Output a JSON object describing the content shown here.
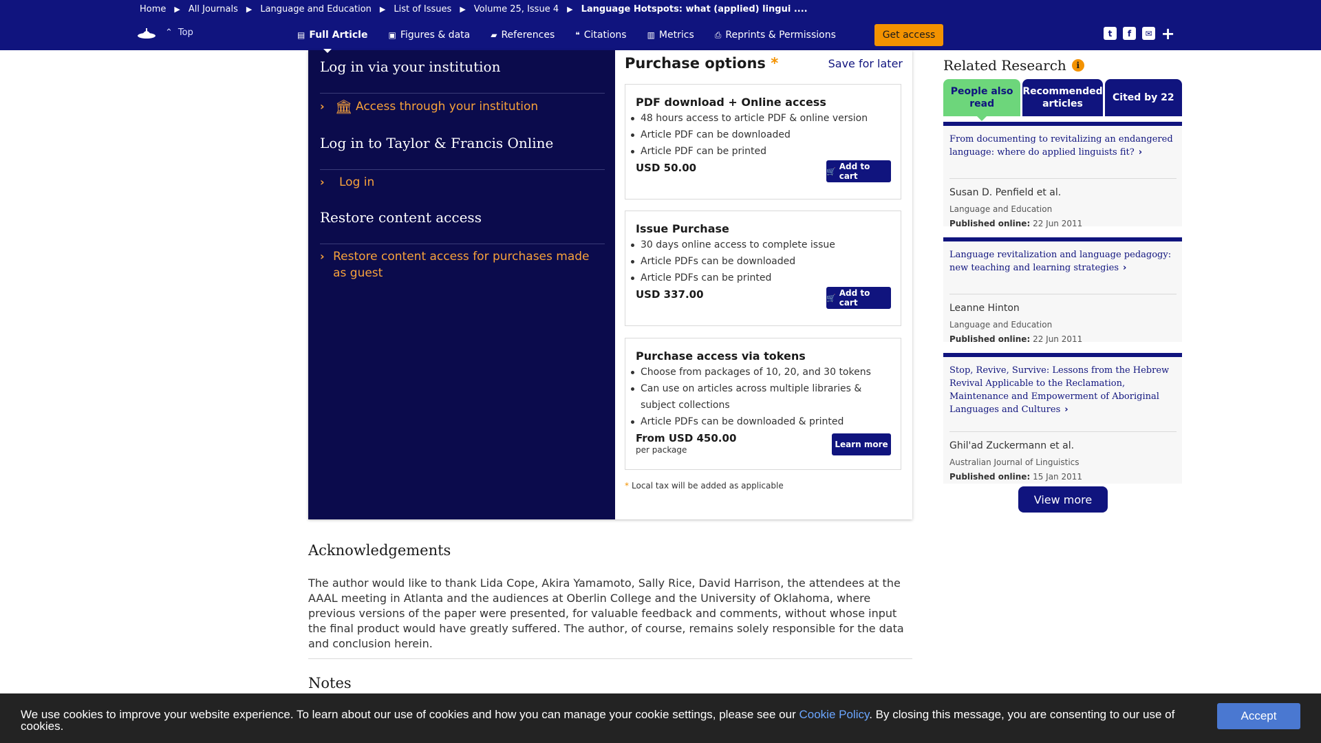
{
  "breadcrumbs": [
    "Home",
    "All Journals",
    "Language and Education",
    "List of Issues",
    "Volume 25, Issue 4",
    "Language Hotspots: what (applied) lingui ...."
  ],
  "header": {
    "top_link": "Top",
    "tabs": [
      {
        "label": "Full Article",
        "icon": "document-icon"
      },
      {
        "label": "Figures & data",
        "icon": "image-icon"
      },
      {
        "label": "References",
        "icon": "book-icon"
      },
      {
        "label": "Citations",
        "icon": "quote-icon"
      },
      {
        "label": "Metrics",
        "icon": "bar-chart-icon"
      },
      {
        "label": "Reprints & Permissions",
        "icon": "printer-icon"
      }
    ],
    "get_access": "Get access",
    "share_icons": [
      "twitter-icon",
      "facebook-icon",
      "email-icon",
      "plus-icon"
    ],
    "bar_color": "#10147e",
    "accent_color": "#f39200"
  },
  "login": {
    "institution_heading": "Log in via your institution",
    "institution_link": "Access through your institution",
    "tf_heading": "Log in to Taylor & Francis Online",
    "tf_link": "Log in",
    "restore_heading": "Restore content access",
    "restore_link": "Restore content access for purchases made as guest"
  },
  "purchase": {
    "title": "Purchase options",
    "star": "*",
    "save_later": "Save for later",
    "options": [
      {
        "title": "PDF download + Online access",
        "features": [
          "48 hours access to article PDF & online version",
          "Article PDF can be downloaded",
          "Article PDF can be printed"
        ],
        "price": "USD 50.00",
        "button": "Add to cart"
      },
      {
        "title": "Issue Purchase",
        "features": [
          "30 days online access to complete issue",
          "Article PDFs can be downloaded",
          "Article PDFs can be printed"
        ],
        "price": "USD 337.00",
        "button": "Add to cart"
      },
      {
        "title": "Purchase access via tokens",
        "features": [
          "Choose from packages of 10, 20, and 30 tokens",
          "Can use on articles across multiple libraries & subject collections",
          "Article PDFs can be downloaded & printed"
        ],
        "price": "From USD 450.00",
        "price_note": "per package",
        "button": "Learn more"
      }
    ],
    "tax_note": "Local tax will be added as applicable"
  },
  "article": {
    "ack_heading": "Acknowledgements",
    "ack_text": "The author would like to thank Lida Cope, Akira Yamamoto, Sally Rice, David Harrison, the attendees at the AAAL meeting in Atlanta and the audiences at Oberlin College and the University of Oklahoma, where previous versions of the paper were presented, for valuable feedback and comments, without whose input the final product would have greatly suffered. The author, of course, remains solely responsible for the data and conclusion herein.",
    "notes_heading": "Notes"
  },
  "related": {
    "title": "Related Research",
    "tabs": [
      "People also read",
      "Recommended articles",
      "Cited by 22"
    ],
    "items": [
      {
        "title": "From documenting to revitalizing an endangered language: where do applied linguists fit?",
        "author": "Susan D. Penfield et al.",
        "journal": "Language and Education",
        "published_label": "Published online:",
        "date": "22 Jun 2011"
      },
      {
        "title": "Language revitalization and language pedagogy: new teaching and learning strategies",
        "author": "Leanne Hinton",
        "journal": "Language and Education",
        "published_label": "Published online:",
        "date": "22 Jun 2011"
      },
      {
        "title": "Stop, Revive, Survive: Lessons from the Hebrew Revival Applicable to the Reclamation, Maintenance and Empowerment of Aboriginal Languages and Cultures",
        "author": "Ghil'ad Zuckermann et al.",
        "journal": "Australian Journal of Linguistics",
        "published_label": "Published online:",
        "date": "15 Jan 2011"
      }
    ],
    "view_more": "View more"
  },
  "cookie": {
    "text_before": "We use cookies to improve your website experience. To learn about our use of cookies and how you can manage your cookie settings, please see our ",
    "link": "Cookie Policy",
    "text_after": ". By closing this message, you are consenting to our use of cookies.",
    "accept": "Accept"
  }
}
